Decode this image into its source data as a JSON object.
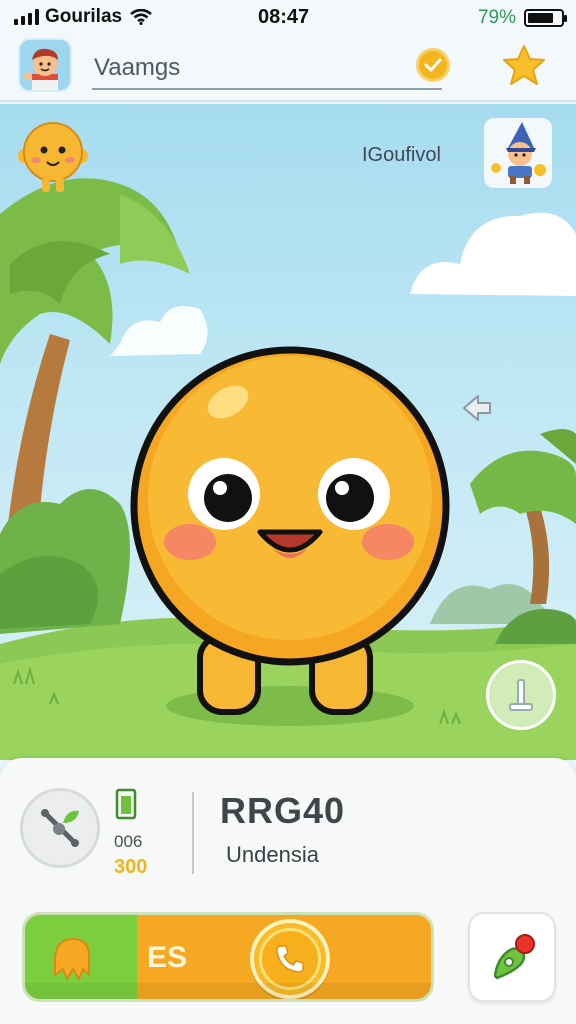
{
  "status_bar": {
    "carrier": "Gourilas",
    "time": "08:47",
    "battery_pct": "79%",
    "battery_level": 0.79
  },
  "header": {
    "title": "Vaamgs",
    "check_icon": "check-icon",
    "star_icon": "star-icon"
  },
  "scene": {
    "user_label": "IGoufivol",
    "colors": {
      "sky": "#a6dcf0",
      "grass": "#8cc954",
      "character": "#f7b733"
    }
  },
  "panel": {
    "stat_a": "006",
    "stat_b": "300",
    "code": "RRG40",
    "subtitle": "Undensia",
    "action_label": "ES",
    "colors": {
      "action_left": "#7bcf3e",
      "action_right": "#f6a823"
    }
  }
}
